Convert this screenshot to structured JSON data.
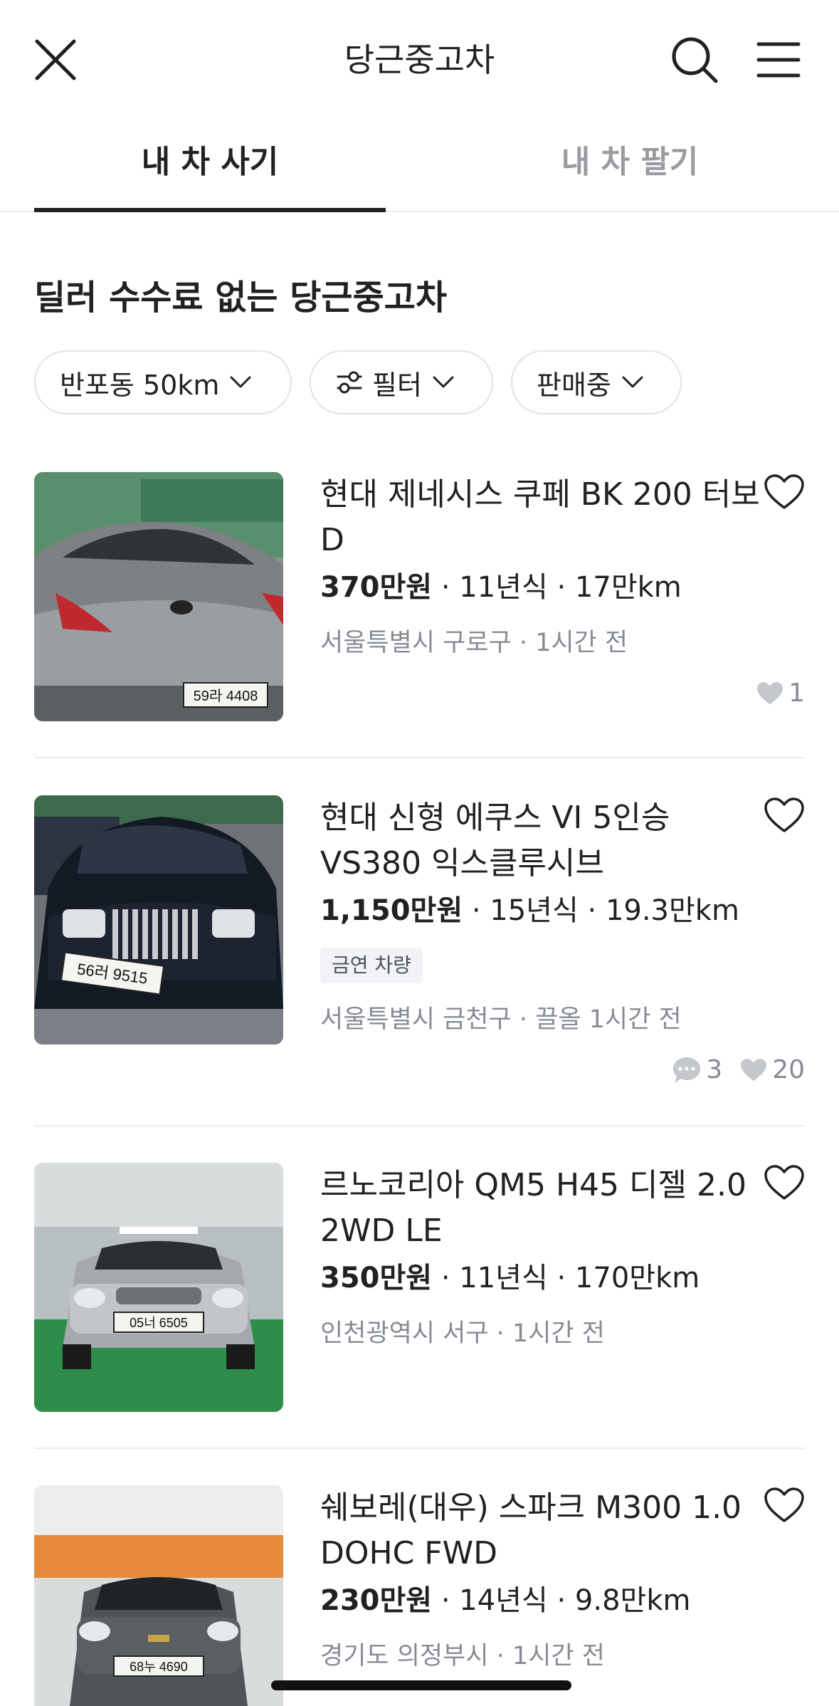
{
  "header": {
    "title": "당근중고차",
    "close_icon": "close-icon",
    "search_icon": "search-icon",
    "menu_icon": "hamburger-menu-icon"
  },
  "tabs": [
    {
      "label": "내 차 사기",
      "active": true
    },
    {
      "label": "내 차 팔기",
      "active": false
    }
  ],
  "headline": "딜러 수수료 없는 당근중고차",
  "filters": {
    "location": "반포동 50km",
    "filter": "필터",
    "status": "판매중"
  },
  "listings": [
    {
      "title": "현대 제네시스 쿠페 BK 200 터보 D",
      "price": "370만원",
      "year": "11년식",
      "mileage": "17만km",
      "location": "서울특별시 구로구",
      "time": "1시간 전",
      "likes": "1"
    },
    {
      "title": "현대 신형 에쿠스 VI 5인승 VS380 익스클루시브",
      "price": "1,150만원",
      "year": "15년식",
      "mileage": "19.3만km",
      "tag": "금연 차량",
      "location": "서울특별시 금천구",
      "time": "끌올 1시간 전",
      "comments": "3",
      "likes": "20"
    },
    {
      "title": "르노코리아 QM5 H45 디젤 2.0 2WD LE",
      "price": "350만원",
      "year": "11년식",
      "mileage": "170만km",
      "location": "인천광역시 서구",
      "time": "1시간 전"
    },
    {
      "title": "쉐보레(대우) 스파크 M300 1.0 DOHC FWD",
      "price": "230만원",
      "year": "14년식",
      "mileage": "9.8만km",
      "location": "경기도 의정부시",
      "time": "1시간 전"
    }
  ],
  "plates": [
    "59라 4408",
    "56러 9515",
    "05너 6505",
    "68누 4690"
  ],
  "colors": {
    "text": "#212124",
    "muted": "#868b94",
    "divider": "#eaebee"
  }
}
